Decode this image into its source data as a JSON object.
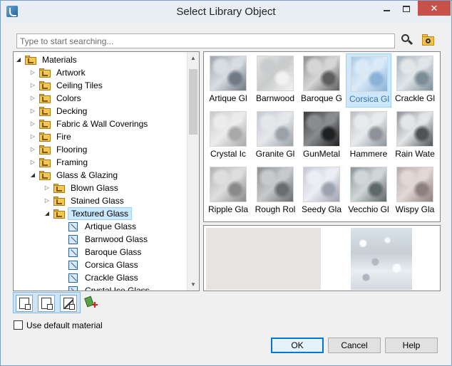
{
  "window": {
    "title": "Select Library Object"
  },
  "search": {
    "placeholder": "Type to start searching..."
  },
  "tree": {
    "items": [
      {
        "label": "Materials",
        "level": 0,
        "expanded": true,
        "icon": "folder-icon"
      },
      {
        "label": "Artwork",
        "level": 1,
        "expanded": false,
        "icon": "folder-icon"
      },
      {
        "label": "Ceiling Tiles",
        "level": 1,
        "expanded": false,
        "icon": "folder-icon"
      },
      {
        "label": "Colors",
        "level": 1,
        "expanded": false,
        "icon": "folder-icon"
      },
      {
        "label": "Decking",
        "level": 1,
        "expanded": false,
        "icon": "folder-icon"
      },
      {
        "label": "Fabric & Wall Coverings",
        "level": 1,
        "expanded": false,
        "icon": "folder-icon"
      },
      {
        "label": "Fire",
        "level": 1,
        "expanded": false,
        "icon": "folder-icon"
      },
      {
        "label": "Flooring",
        "level": 1,
        "expanded": false,
        "icon": "folder-icon"
      },
      {
        "label": "Framing",
        "level": 1,
        "expanded": false,
        "icon": "folder-icon"
      },
      {
        "label": "Glass & Glazing",
        "level": 1,
        "expanded": true,
        "icon": "folder-icon"
      },
      {
        "label": "Blown Glass",
        "level": 2,
        "expanded": false,
        "icon": "folder-icon"
      },
      {
        "label": "Stained Glass",
        "level": 2,
        "expanded": false,
        "icon": "folder-icon"
      },
      {
        "label": "Textured Glass",
        "level": 2,
        "expanded": true,
        "icon": "folder-icon",
        "selected": true
      },
      {
        "label": "Artique Glass",
        "level": 3,
        "icon": "material-icon"
      },
      {
        "label": "Barnwood Glass",
        "level": 3,
        "icon": "material-icon"
      },
      {
        "label": "Baroque Glass",
        "level": 3,
        "icon": "material-icon"
      },
      {
        "label": "Corsica Glass",
        "level": 3,
        "icon": "material-icon"
      },
      {
        "label": "Crackle Glass",
        "level": 3,
        "icon": "material-icon"
      },
      {
        "label": "Crystal Ice Glass",
        "level": 3,
        "icon": "material-icon"
      }
    ]
  },
  "thumbnails": [
    {
      "label": "Artique Gl",
      "colors": [
        "#9ba5ae",
        "#d8dde2",
        "#6f7a84"
      ]
    },
    {
      "label": "Barnwood",
      "colors": [
        "#e2e3e3",
        "#c9cbcc",
        "#f2f2f2"
      ]
    },
    {
      "label": "Baroque G",
      "colors": [
        "#8f8f8f",
        "#d6d6d6",
        "#5e5e5e"
      ]
    },
    {
      "label": "Corsica Gl",
      "colors": [
        "#a9cbe8",
        "#dbeaf7",
        "#8ab2d6"
      ],
      "selected": true
    },
    {
      "label": "Crackle Gl",
      "colors": [
        "#9fb0b8",
        "#e1e6e9",
        "#7d8d96"
      ]
    },
    {
      "label": "Crystal Ic",
      "colors": [
        "#c9c9c9",
        "#ececec",
        "#a8a8a8"
      ]
    },
    {
      "label": "Granite Gl",
      "colors": [
        "#c3c8ce",
        "#e5e8eb",
        "#9aa1a8"
      ]
    },
    {
      "label": "GunMetal",
      "colors": [
        "#3a3c3f",
        "#8a8d90",
        "#1f2022"
      ]
    },
    {
      "label": "Hammere",
      "colors": [
        "#b9bec2",
        "#e8ebed",
        "#8c9297"
      ]
    },
    {
      "label": "Rain Wate",
      "colors": [
        "#8e9296",
        "#e3e5e7",
        "#4f5356"
      ]
    },
    {
      "label": "Ripple Gla",
      "colors": [
        "#b1b1b1",
        "#dedede",
        "#8a8a8a"
      ]
    },
    {
      "label": "Rough Rol",
      "colors": [
        "#8d8f93",
        "#c7cacd",
        "#6a6d70"
      ]
    },
    {
      "label": "Seedy Gla",
      "colors": [
        "#c4c7d2",
        "#eceef3",
        "#9ea2b0"
      ]
    },
    {
      "label": "Vecchio Gl",
      "colors": [
        "#8a9496",
        "#cfd6d8",
        "#5f686a"
      ]
    },
    {
      "label": "Wispy Gla",
      "colors": [
        "#b8a9a6",
        "#e2d8d5",
        "#8d7f7c"
      ]
    }
  ],
  "options": {
    "use_default_material": "Use default material"
  },
  "buttons": {
    "ok": "OK",
    "cancel": "Cancel",
    "help": "Help"
  }
}
